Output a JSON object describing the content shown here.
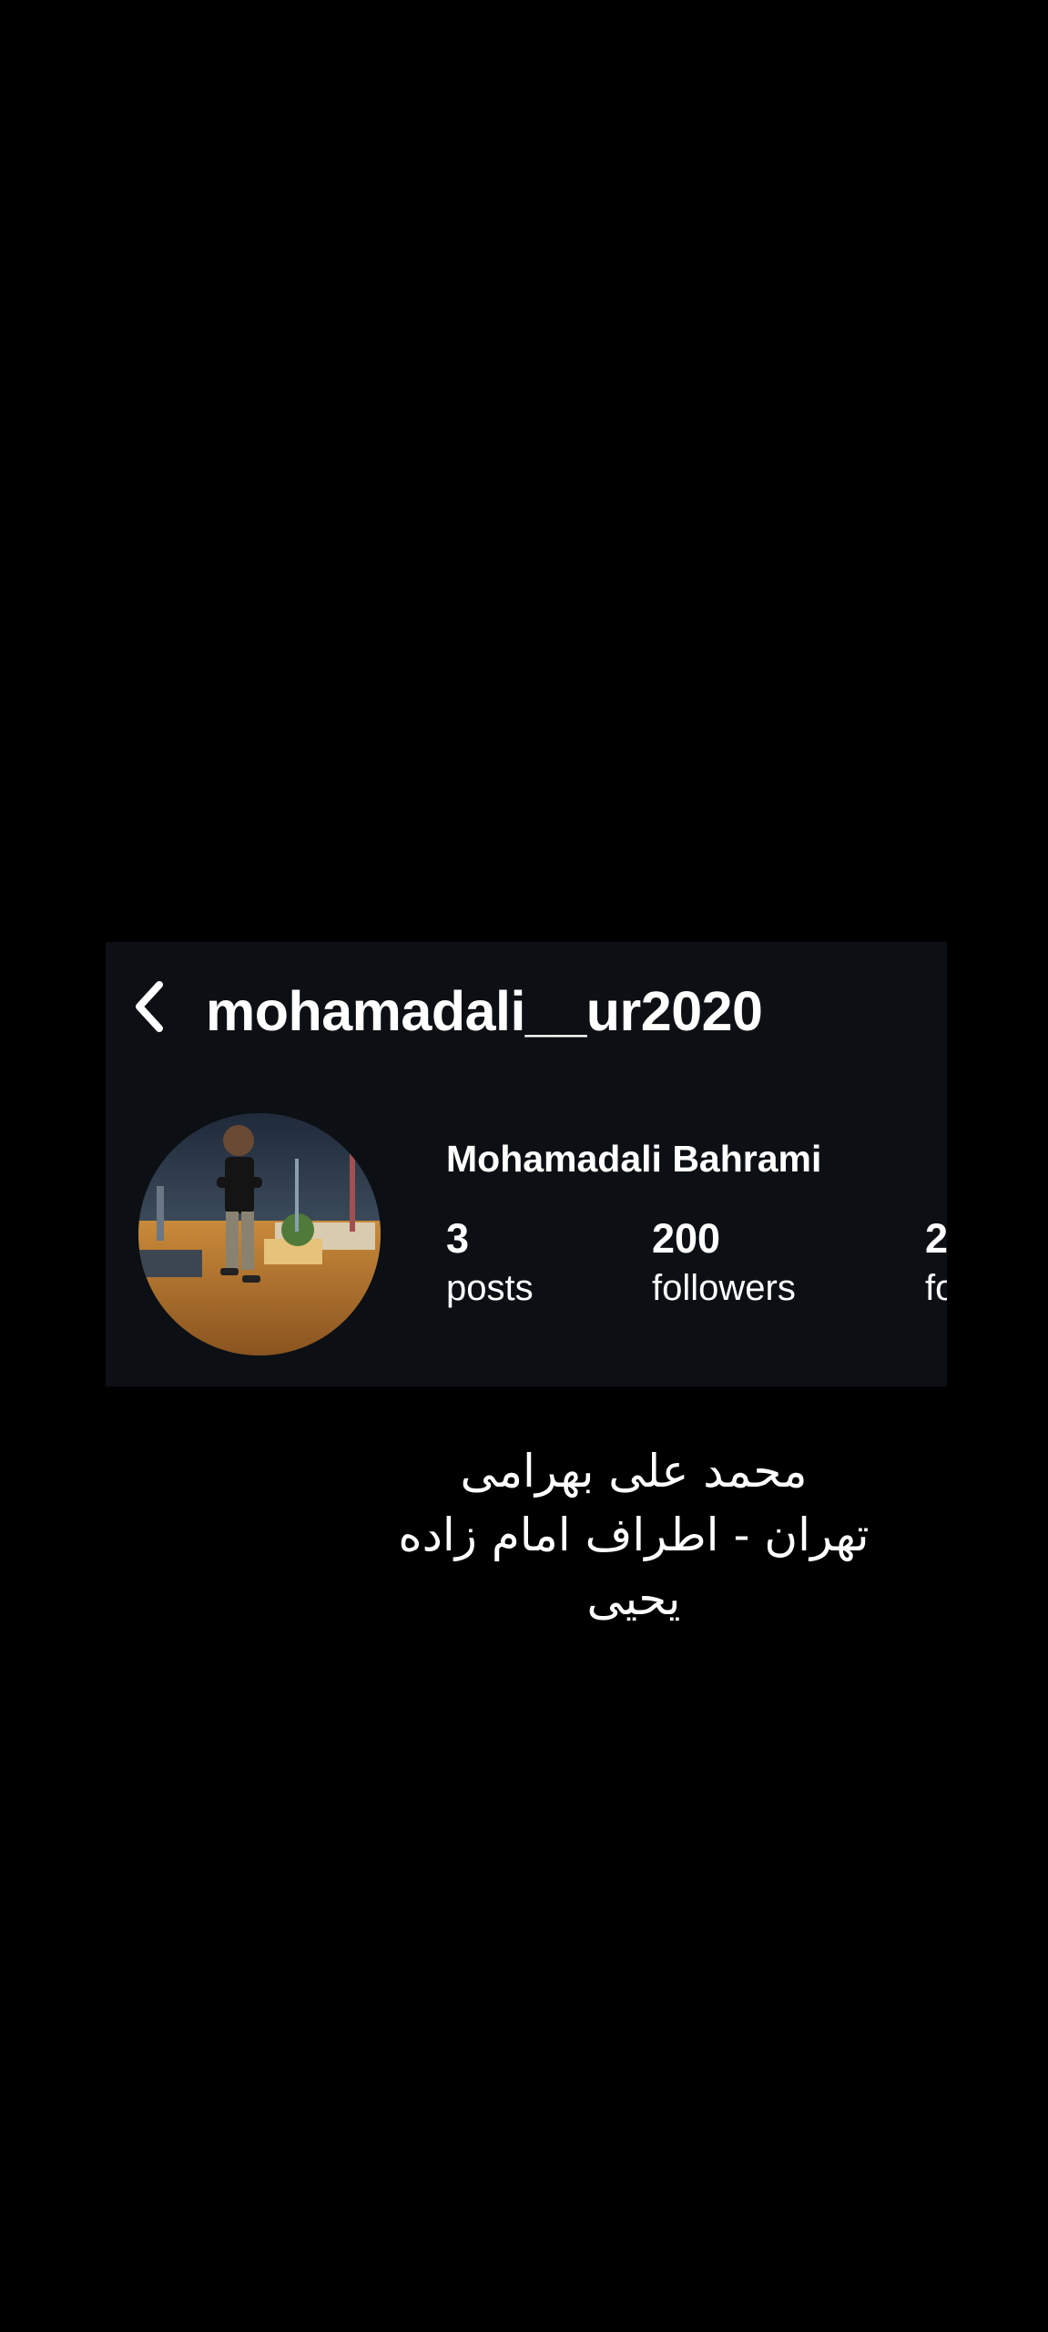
{
  "header": {
    "username": "mohamadali__ur2020",
    "back_icon": "chevron-left-icon"
  },
  "profile": {
    "full_name": "Mohamadali Bahrami",
    "avatar_icon": "avatar-photo",
    "stats": {
      "posts": {
        "value": "3",
        "label": "posts"
      },
      "followers": {
        "value": "200",
        "label": "followers"
      },
      "following": {
        "value": "2",
        "label": "fo"
      }
    }
  },
  "bio": {
    "line1": "محمد علی بهرامی",
    "line2": "تهران - اطراف امام زاده",
    "line3": "یحیی"
  },
  "colors": {
    "background": "#000000",
    "card": "#0c1014",
    "text": "#ffffff"
  }
}
